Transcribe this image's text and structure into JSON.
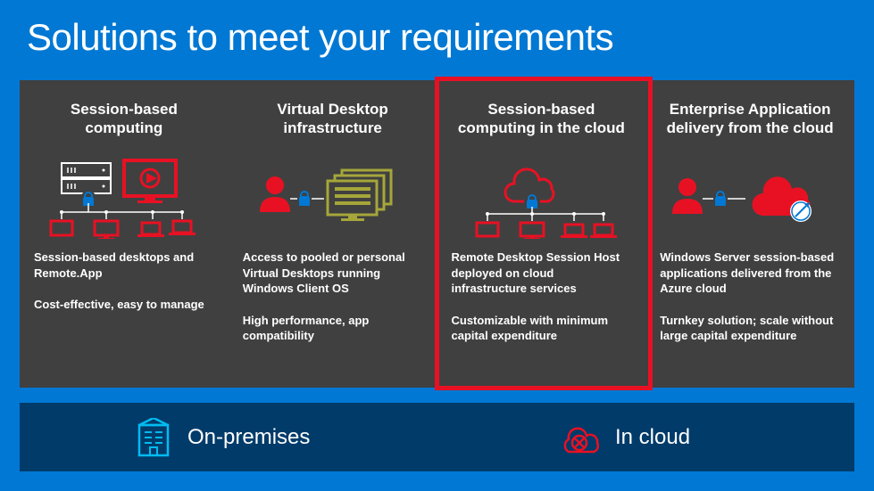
{
  "title": "Solutions to meet your requirements",
  "columns": [
    {
      "title": "Session-based computing",
      "desc1": "Session-based desktops and Remote.App",
      "desc2": "Cost-effective, easy to manage"
    },
    {
      "title": "Virtual Desktop infrastructure",
      "desc1": "Access to pooled or personal Virtual Desktops running Windows Client OS",
      "desc2": "High performance, app compatibility"
    },
    {
      "title": "Session-based computing in the cloud",
      "desc1": "Remote Desktop Session Host deployed on cloud infrastructure services",
      "desc2": "Customizable with minimum capital expenditure"
    },
    {
      "title": "Enterprise Application delivery from the cloud",
      "desc1": "Windows Server session-based applications delivered from the Azure cloud",
      "desc2": "Turnkey solution; scale without large capital expenditure"
    }
  ],
  "footer": {
    "left": "On-premises",
    "right": "In cloud"
  },
  "colors": {
    "bg": "#0078d4",
    "panel": "#404040",
    "footer": "#003b6a",
    "red": "#e81123",
    "olive": "#a6a63a"
  }
}
